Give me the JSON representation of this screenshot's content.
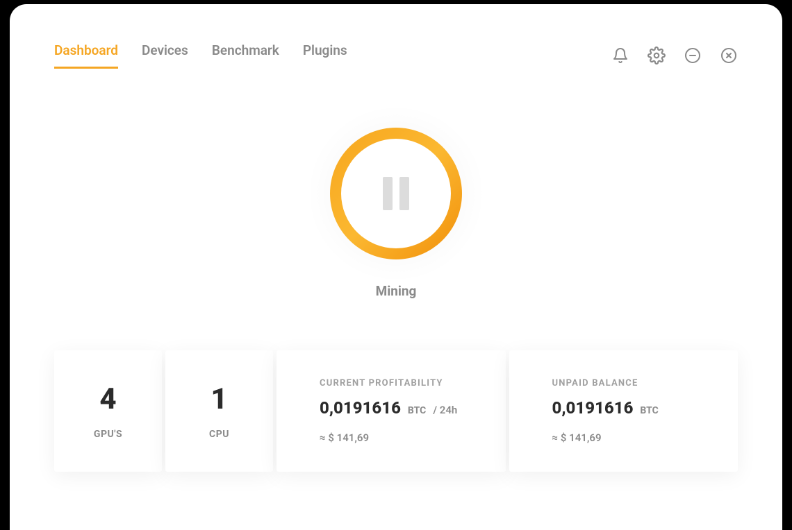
{
  "tabs": [
    {
      "label": "Dashboard",
      "active": true
    },
    {
      "label": "Devices",
      "active": false
    },
    {
      "label": "Benchmark",
      "active": false
    },
    {
      "label": "Plugins",
      "active": false
    }
  ],
  "mining": {
    "status_label": "Mining"
  },
  "stats": {
    "gpu": {
      "value": "4",
      "label": "GPU'S"
    },
    "cpu": {
      "value": "1",
      "label": "CPU"
    },
    "profitability": {
      "label": "CURRENT PROFITABILITY",
      "value": "0,0191616",
      "unit": "BTC",
      "period": "/ 24h",
      "approx": "≈ $ 141,69"
    },
    "balance": {
      "label": "UNPAID BALANCE",
      "value": "0,0191616",
      "unit": "BTC",
      "approx": "≈ $ 141,69"
    }
  },
  "colors": {
    "accent": "#f5a623"
  }
}
